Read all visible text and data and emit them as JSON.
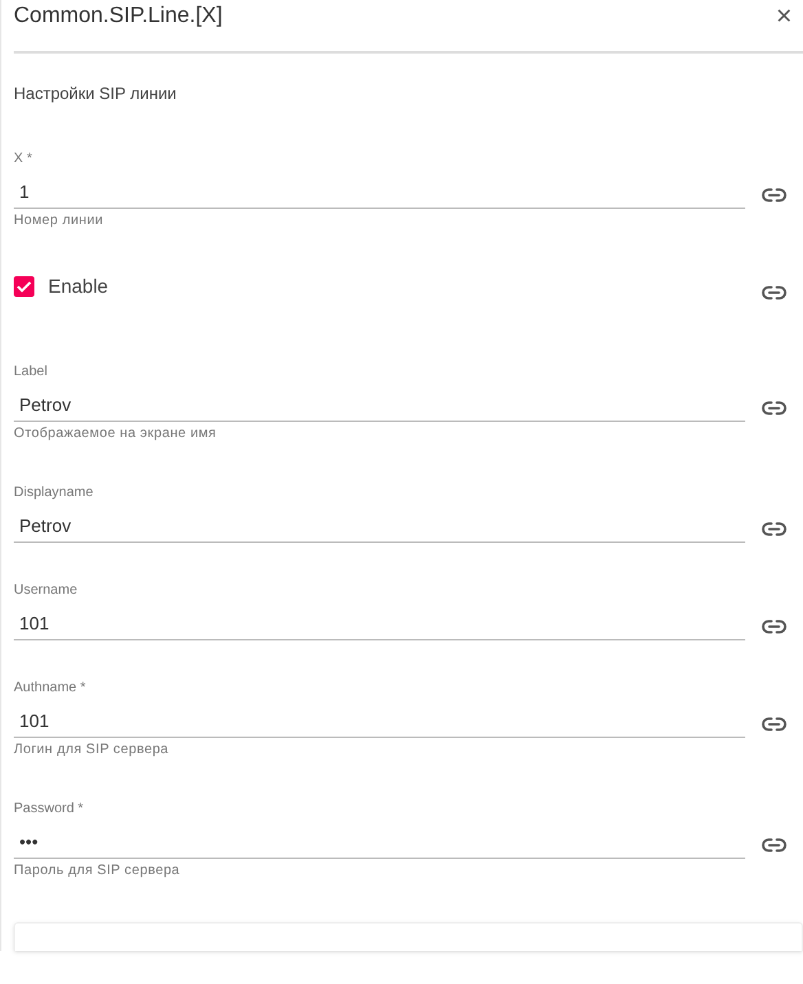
{
  "dialog": {
    "title": "Common.SIP.Line.[X]",
    "close": "×"
  },
  "section": {
    "title": "Настройки SIP линии"
  },
  "fields": [
    {
      "kind": "text",
      "label": "X",
      "mark": "*",
      "value": "1",
      "helper": "Номер линии"
    },
    {
      "kind": "checkbox",
      "label": "Enable",
      "checked": true
    },
    {
      "kind": "text",
      "label": "Label",
      "value": "Petrov",
      "helper": "Отображаемое на экране имя"
    },
    {
      "kind": "text",
      "label": "Displayname",
      "value": "Petrov"
    },
    {
      "kind": "text",
      "label": "Username",
      "value": "101"
    },
    {
      "kind": "text",
      "label": "Authname",
      "mark": "*",
      "value": "101",
      "helper": "Логин для SIP сервера"
    },
    {
      "kind": "text",
      "label": "Password",
      "mark": "*",
      "value": "•••",
      "helper": "Пароль для SIP сервера"
    }
  ]
}
